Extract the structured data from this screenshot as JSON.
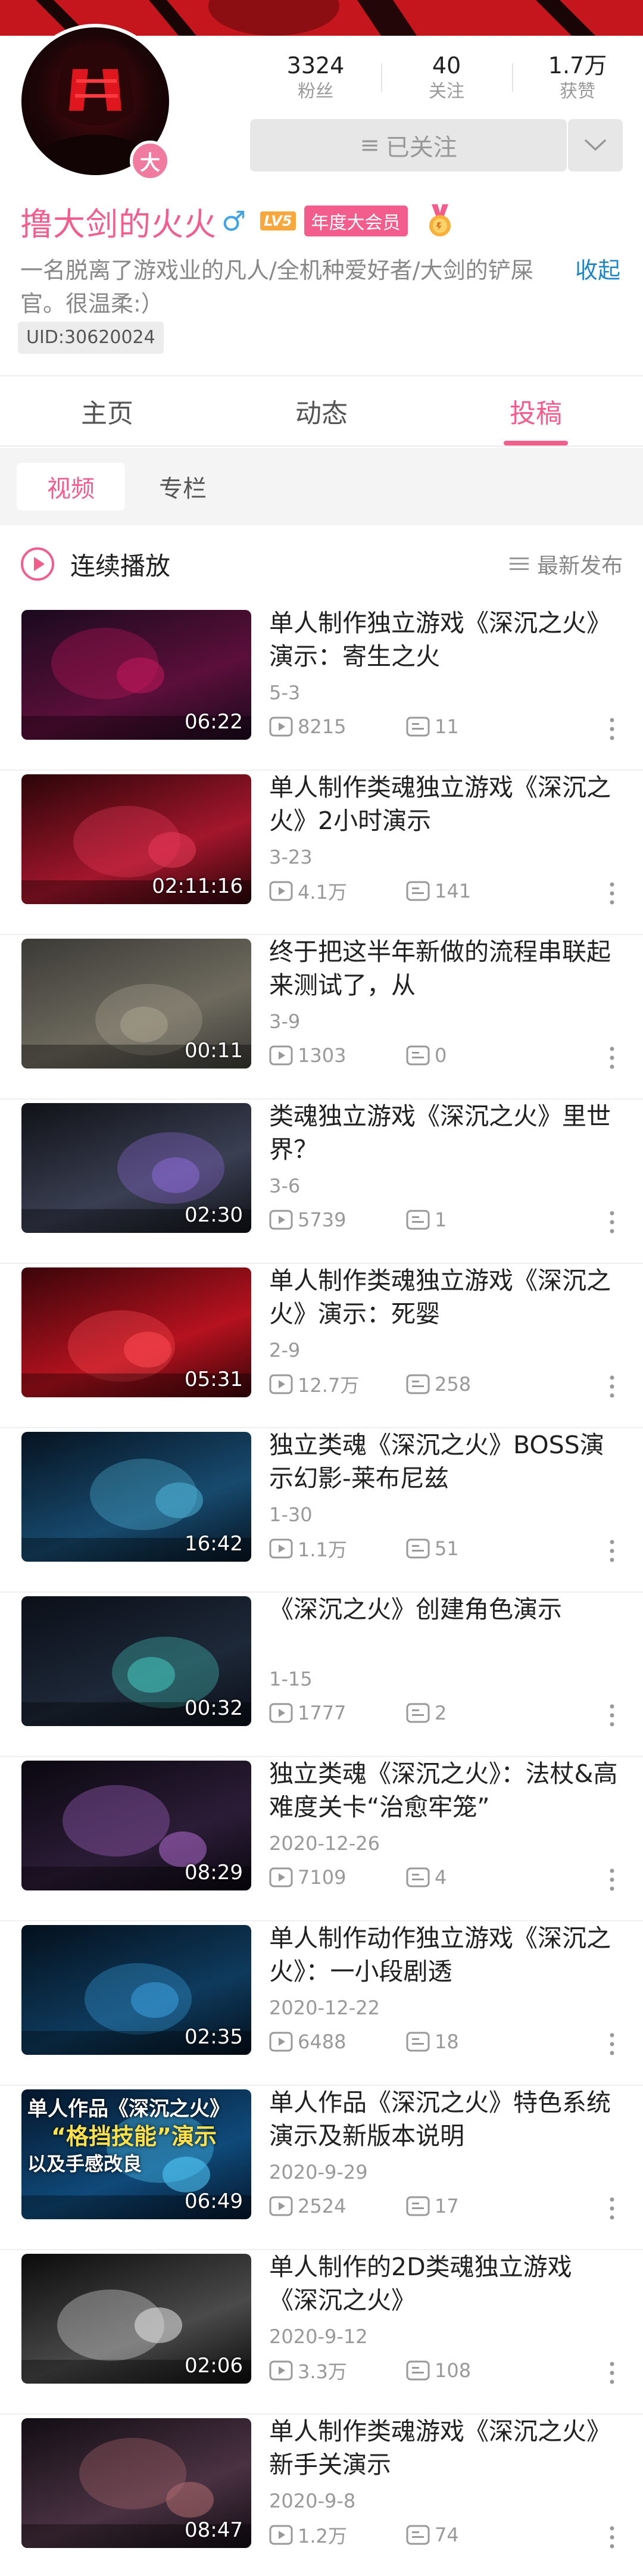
{
  "profile": {
    "avatar_badge": "大",
    "stats": [
      {
        "value": "3324",
        "label": "粉丝"
      },
      {
        "value": "40",
        "label": "关注"
      },
      {
        "value": "1.7万",
        "label": "获赞"
      }
    ],
    "follow_button": "已关注",
    "name": "撸大剑的火火",
    "gender": "♂",
    "level": "LV5",
    "vip": "年度大会员",
    "bio": "一名脱离了游戏业的凡人/全机种爱好者/大剑的铲屎官。很温柔:）",
    "collapse": "收起",
    "uid": "UID:30620024"
  },
  "tabs": [
    "主页",
    "动态",
    "投稿"
  ],
  "active_tab": 2,
  "subtabs": [
    "视频",
    "专栏"
  ],
  "playbar": {
    "label": "连续播放",
    "sort": "最新发布"
  },
  "colors": {
    "accent": "#f25d8e",
    "link": "#1e86c7",
    "gender": "#3ba3e6"
  },
  "videos": [
    {
      "title": "单人制作独立游戏《深沉之火》演示：寄生之火",
      "date": "5-3",
      "plays": "8215",
      "danmaku": "11",
      "duration": "06:22"
    },
    {
      "title": "单人制作类魂独立游戏《深沉之火》2小时演示",
      "date": "3-23",
      "plays": "4.1万",
      "danmaku": "141",
      "duration": "02:11:16"
    },
    {
      "title": "终于把这半年新做的流程串联起来测试了，从",
      "date": "3-9",
      "plays": "1303",
      "danmaku": "0",
      "duration": "00:11"
    },
    {
      "title": "类魂独立游戏《深沉之火》里世界？",
      "date": "3-6",
      "plays": "5739",
      "danmaku": "1",
      "duration": "02:30"
    },
    {
      "title": "单人制作类魂独立游戏《深沉之火》演示：死婴",
      "date": "2-9",
      "plays": "12.7万",
      "danmaku": "258",
      "duration": "05:31"
    },
    {
      "title": "独立类魂《深沉之火》BOSS演示幻影-莱布尼兹",
      "date": "1-30",
      "plays": "1.1万",
      "danmaku": "51",
      "duration": "16:42"
    },
    {
      "title": "《深沉之火》创建角色演示",
      "date": "1-15",
      "plays": "1777",
      "danmaku": "2",
      "duration": "00:32"
    },
    {
      "title": "独立类魂《深沉之火》：法杖&高难度关卡“治愈牢笼”",
      "date": "2020-12-26",
      "plays": "7109",
      "danmaku": "4",
      "duration": "08:29"
    },
    {
      "title": "单人制作动作独立游戏《深沉之火》：一小段剧透",
      "date": "2020-12-22",
      "plays": "6488",
      "danmaku": "18",
      "duration": "02:35"
    },
    {
      "title": "单人作品《深沉之火》特色系统演示及新版本说明",
      "date": "2020-9-29",
      "plays": "2524",
      "danmaku": "17",
      "duration": "06:49",
      "thumb_text": [
        "单人作品《深沉之火》",
        "“格挡技能”演示",
        "以及手感改良"
      ]
    },
    {
      "title": "单人制作的2D类魂独立游戏《深沉之火》",
      "date": "2020-9-12",
      "plays": "3.3万",
      "danmaku": "108",
      "duration": "02:06"
    },
    {
      "title": "单人制作类魂游戏《深沉之火》新手关演示",
      "date": "2020-9-8",
      "plays": "1.2万",
      "danmaku": "74",
      "duration": "08:47"
    }
  ]
}
